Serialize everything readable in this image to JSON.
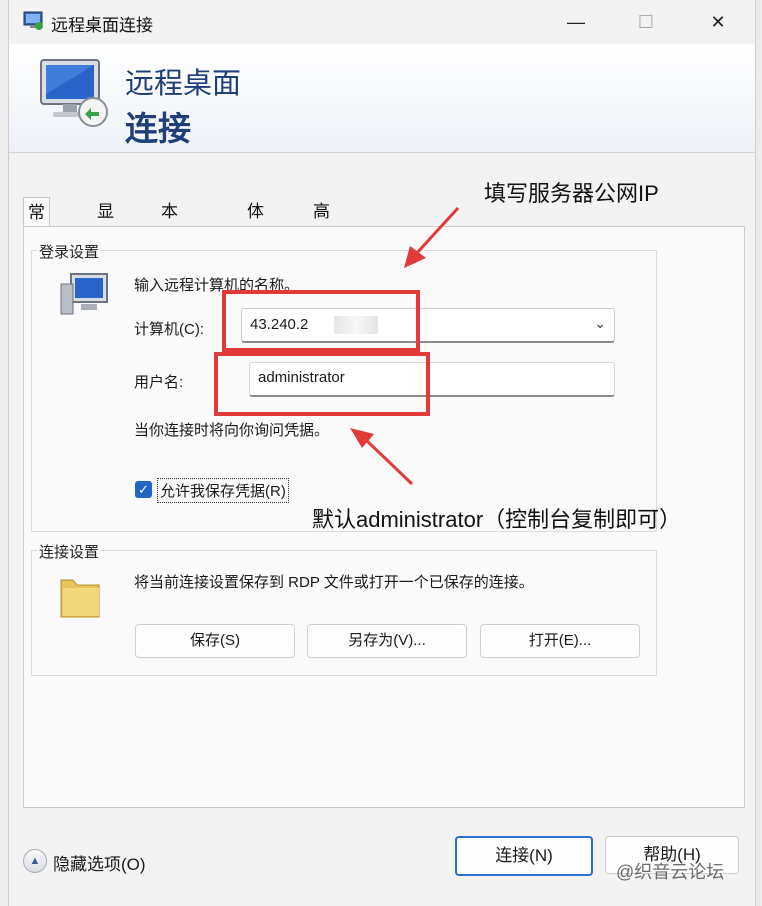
{
  "window": {
    "title": "远程桌面连接",
    "banner_line1": "远程桌面",
    "banner_line2": "连接",
    "controls": [
      "minimize",
      "maximize",
      "close"
    ]
  },
  "tabs": [
    {
      "label": "常规",
      "active": true
    },
    {
      "label": "显示",
      "active": false
    },
    {
      "label": "本地资源",
      "active": false
    },
    {
      "label": "体验",
      "active": false
    },
    {
      "label": "高级",
      "active": false
    }
  ],
  "login": {
    "legend": "登录设置",
    "intro": "输入远程计算机的名称。",
    "computer_label": "计算机(C):",
    "computer_value": "43.240.2",
    "username_label": "用户名:",
    "username_value": "administrator",
    "hint": "当你连接时将向你询问凭据。",
    "save_creds_label": "允许我保存凭据(R)",
    "save_creds_checked": true
  },
  "connection": {
    "legend": "连接设置",
    "description": "将当前连接设置保存到 RDP 文件或打开一个已保存的连接。",
    "save_button": "保存(S)",
    "save_as_button": "另存为(V)...",
    "open_button": "打开(E)..."
  },
  "footer": {
    "hide_options": "隐藏选项(O)",
    "connect_button": "连接(N)",
    "help_button": "帮助(H)"
  },
  "annotations": {
    "fill_ip": "填写服务器公网IP",
    "default_admin": "默认administrator（控制台复制即可）"
  },
  "watermark": "@织音云论坛",
  "colors": {
    "annotation_red": "#e23a3a",
    "banner_text": "#1f3f78",
    "accent_blue": "#2166c5"
  }
}
